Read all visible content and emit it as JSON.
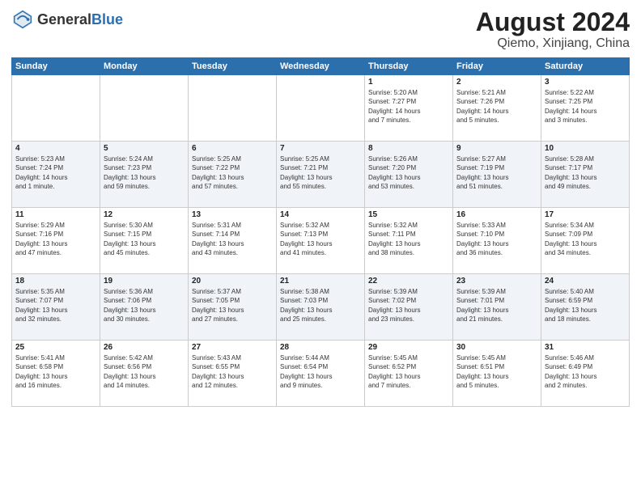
{
  "logo": {
    "general": "General",
    "blue": "Blue"
  },
  "title": "August 2024",
  "subtitle": "Qiemo, Xinjiang, China",
  "days_of_week": [
    "Sunday",
    "Monday",
    "Tuesday",
    "Wednesday",
    "Thursday",
    "Friday",
    "Saturday"
  ],
  "weeks": [
    [
      {
        "day": "",
        "info": ""
      },
      {
        "day": "",
        "info": ""
      },
      {
        "day": "",
        "info": ""
      },
      {
        "day": "",
        "info": ""
      },
      {
        "day": "1",
        "info": "Sunrise: 5:20 AM\nSunset: 7:27 PM\nDaylight: 14 hours\nand 7 minutes."
      },
      {
        "day": "2",
        "info": "Sunrise: 5:21 AM\nSunset: 7:26 PM\nDaylight: 14 hours\nand 5 minutes."
      },
      {
        "day": "3",
        "info": "Sunrise: 5:22 AM\nSunset: 7:25 PM\nDaylight: 14 hours\nand 3 minutes."
      }
    ],
    [
      {
        "day": "4",
        "info": "Sunrise: 5:23 AM\nSunset: 7:24 PM\nDaylight: 14 hours\nand 1 minute."
      },
      {
        "day": "5",
        "info": "Sunrise: 5:24 AM\nSunset: 7:23 PM\nDaylight: 13 hours\nand 59 minutes."
      },
      {
        "day": "6",
        "info": "Sunrise: 5:25 AM\nSunset: 7:22 PM\nDaylight: 13 hours\nand 57 minutes."
      },
      {
        "day": "7",
        "info": "Sunrise: 5:25 AM\nSunset: 7:21 PM\nDaylight: 13 hours\nand 55 minutes."
      },
      {
        "day": "8",
        "info": "Sunrise: 5:26 AM\nSunset: 7:20 PM\nDaylight: 13 hours\nand 53 minutes."
      },
      {
        "day": "9",
        "info": "Sunrise: 5:27 AM\nSunset: 7:19 PM\nDaylight: 13 hours\nand 51 minutes."
      },
      {
        "day": "10",
        "info": "Sunrise: 5:28 AM\nSunset: 7:17 PM\nDaylight: 13 hours\nand 49 minutes."
      }
    ],
    [
      {
        "day": "11",
        "info": "Sunrise: 5:29 AM\nSunset: 7:16 PM\nDaylight: 13 hours\nand 47 minutes."
      },
      {
        "day": "12",
        "info": "Sunrise: 5:30 AM\nSunset: 7:15 PM\nDaylight: 13 hours\nand 45 minutes."
      },
      {
        "day": "13",
        "info": "Sunrise: 5:31 AM\nSunset: 7:14 PM\nDaylight: 13 hours\nand 43 minutes."
      },
      {
        "day": "14",
        "info": "Sunrise: 5:32 AM\nSunset: 7:13 PM\nDaylight: 13 hours\nand 41 minutes."
      },
      {
        "day": "15",
        "info": "Sunrise: 5:32 AM\nSunset: 7:11 PM\nDaylight: 13 hours\nand 38 minutes."
      },
      {
        "day": "16",
        "info": "Sunrise: 5:33 AM\nSunset: 7:10 PM\nDaylight: 13 hours\nand 36 minutes."
      },
      {
        "day": "17",
        "info": "Sunrise: 5:34 AM\nSunset: 7:09 PM\nDaylight: 13 hours\nand 34 minutes."
      }
    ],
    [
      {
        "day": "18",
        "info": "Sunrise: 5:35 AM\nSunset: 7:07 PM\nDaylight: 13 hours\nand 32 minutes."
      },
      {
        "day": "19",
        "info": "Sunrise: 5:36 AM\nSunset: 7:06 PM\nDaylight: 13 hours\nand 30 minutes."
      },
      {
        "day": "20",
        "info": "Sunrise: 5:37 AM\nSunset: 7:05 PM\nDaylight: 13 hours\nand 27 minutes."
      },
      {
        "day": "21",
        "info": "Sunrise: 5:38 AM\nSunset: 7:03 PM\nDaylight: 13 hours\nand 25 minutes."
      },
      {
        "day": "22",
        "info": "Sunrise: 5:39 AM\nSunset: 7:02 PM\nDaylight: 13 hours\nand 23 minutes."
      },
      {
        "day": "23",
        "info": "Sunrise: 5:39 AM\nSunset: 7:01 PM\nDaylight: 13 hours\nand 21 minutes."
      },
      {
        "day": "24",
        "info": "Sunrise: 5:40 AM\nSunset: 6:59 PM\nDaylight: 13 hours\nand 18 minutes."
      }
    ],
    [
      {
        "day": "25",
        "info": "Sunrise: 5:41 AM\nSunset: 6:58 PM\nDaylight: 13 hours\nand 16 minutes."
      },
      {
        "day": "26",
        "info": "Sunrise: 5:42 AM\nSunset: 6:56 PM\nDaylight: 13 hours\nand 14 minutes."
      },
      {
        "day": "27",
        "info": "Sunrise: 5:43 AM\nSunset: 6:55 PM\nDaylight: 13 hours\nand 12 minutes."
      },
      {
        "day": "28",
        "info": "Sunrise: 5:44 AM\nSunset: 6:54 PM\nDaylight: 13 hours\nand 9 minutes."
      },
      {
        "day": "29",
        "info": "Sunrise: 5:45 AM\nSunset: 6:52 PM\nDaylight: 13 hours\nand 7 minutes."
      },
      {
        "day": "30",
        "info": "Sunrise: 5:45 AM\nSunset: 6:51 PM\nDaylight: 13 hours\nand 5 minutes."
      },
      {
        "day": "31",
        "info": "Sunrise: 5:46 AM\nSunset: 6:49 PM\nDaylight: 13 hours\nand 2 minutes."
      }
    ]
  ]
}
